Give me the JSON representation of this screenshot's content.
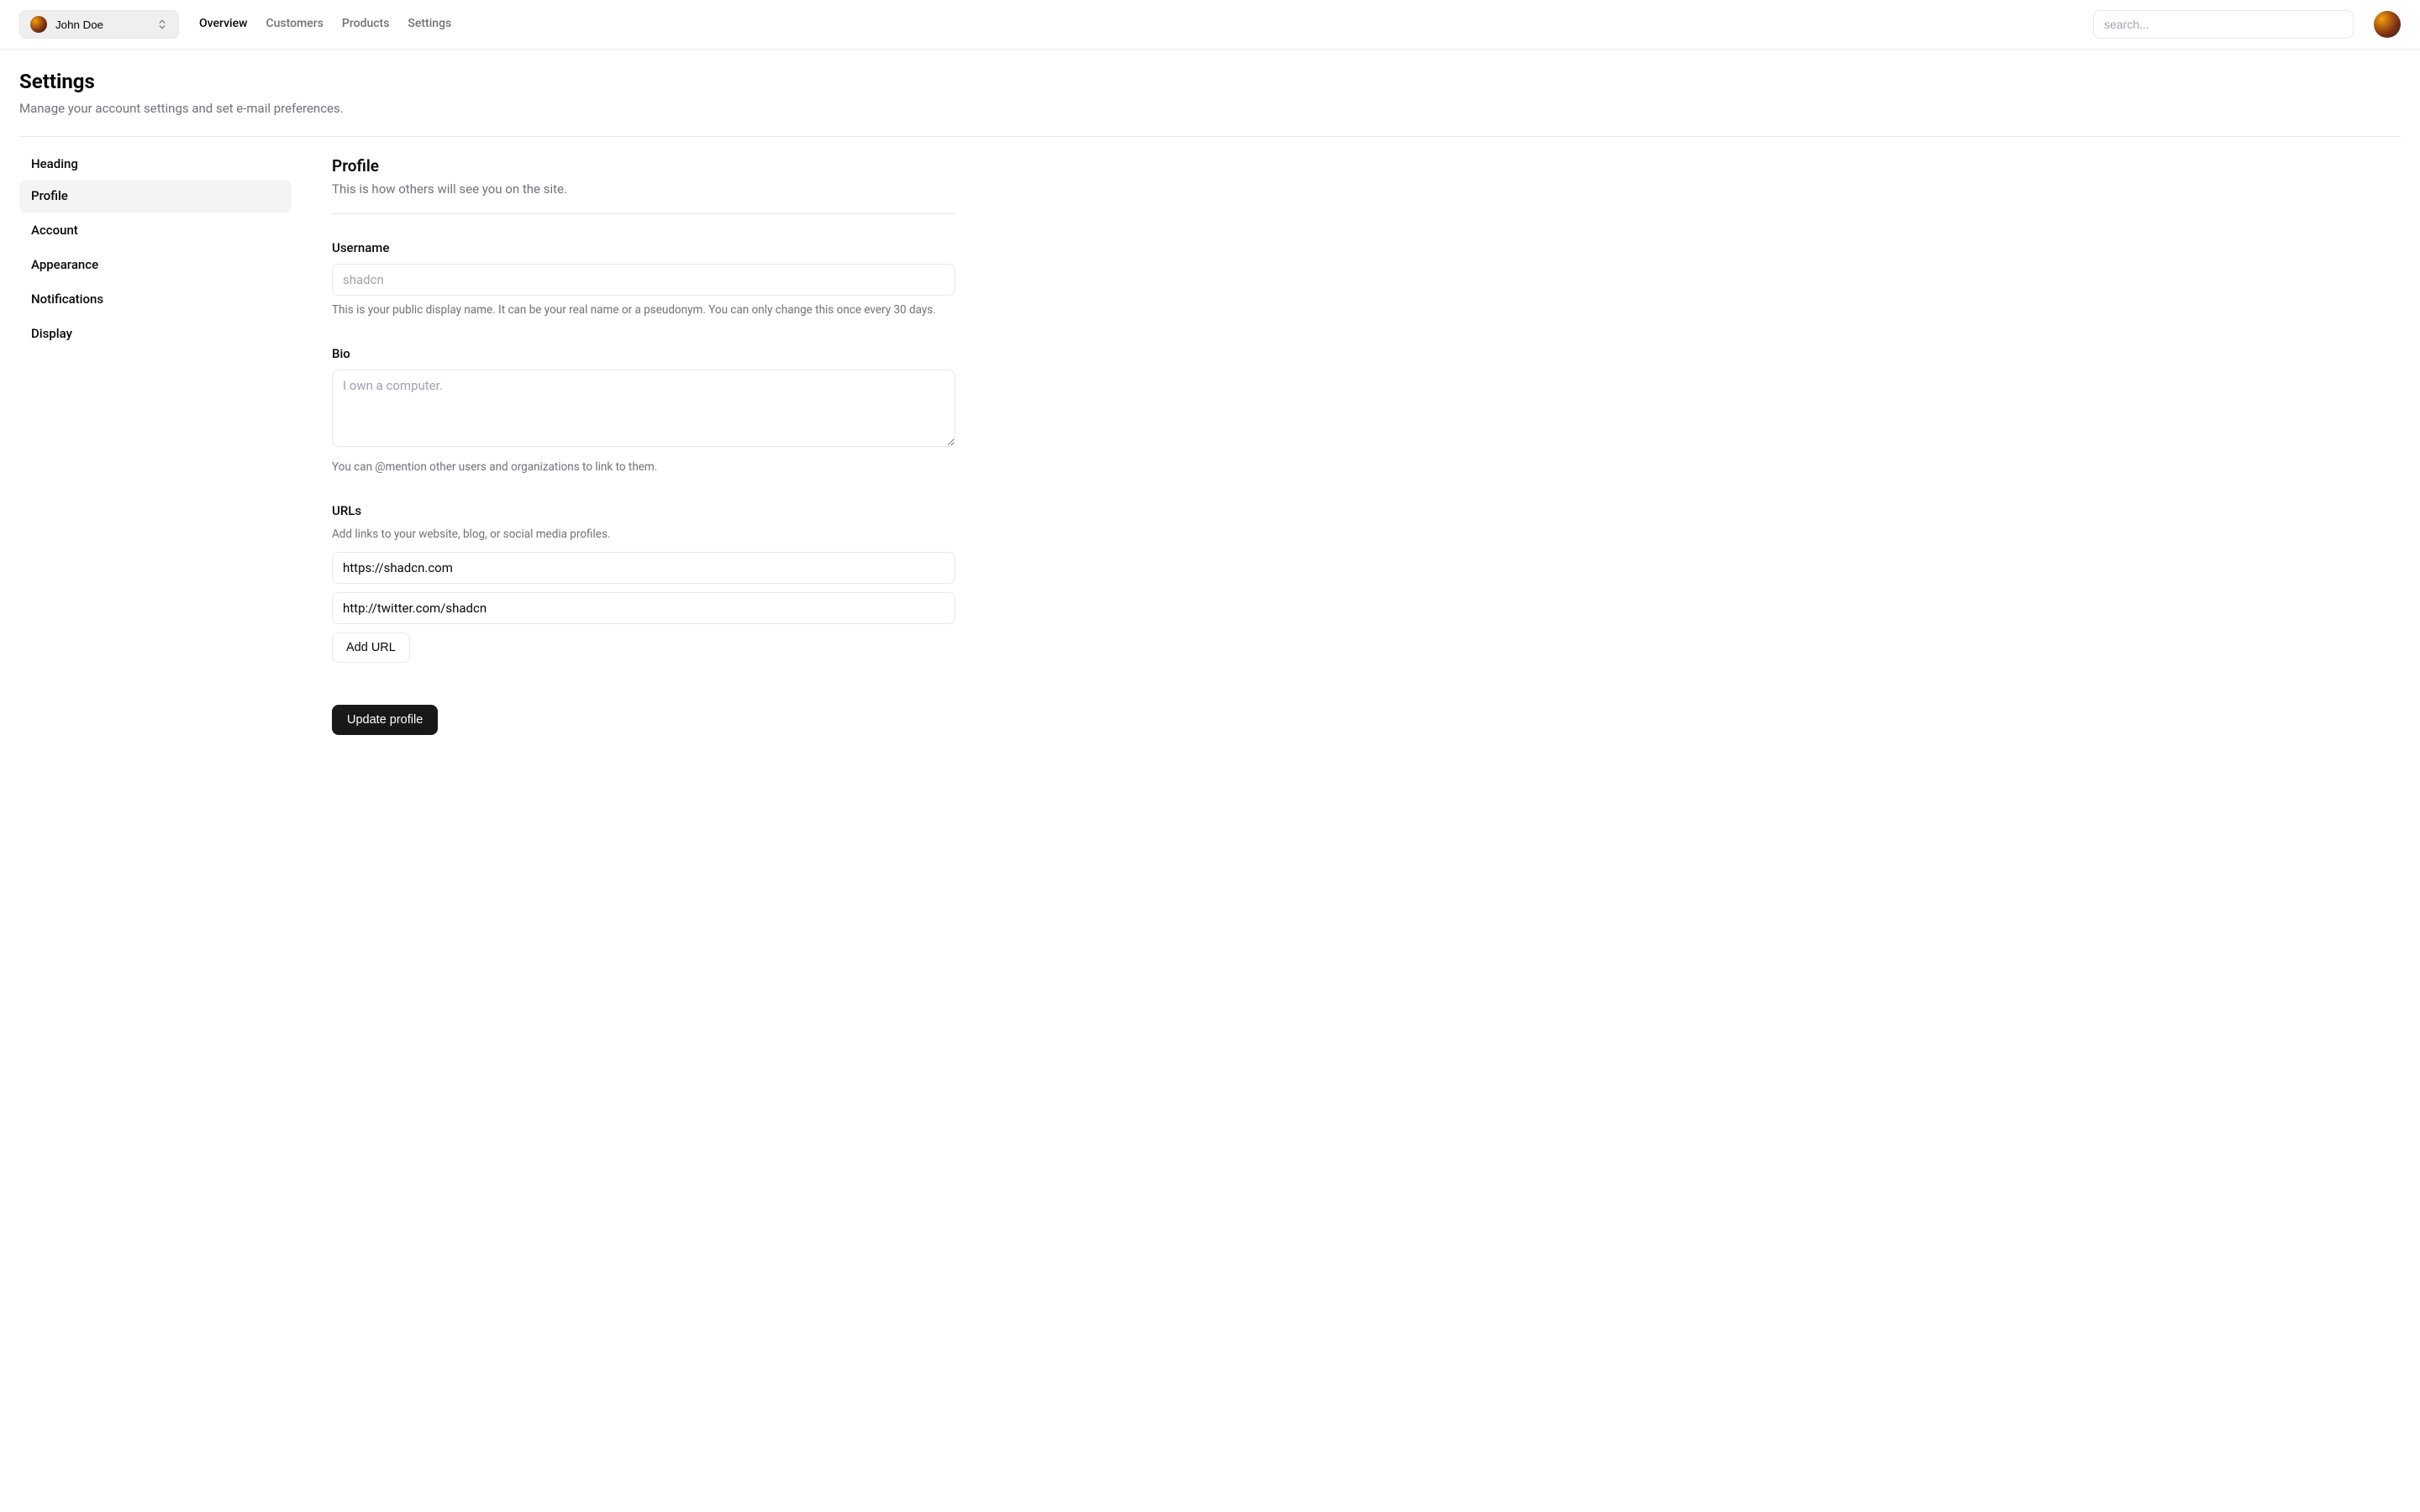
{
  "topbar": {
    "team_name": "John Doe",
    "nav": [
      {
        "label": "Overview",
        "active": true
      },
      {
        "label": "Customers",
        "active": false
      },
      {
        "label": "Products",
        "active": false
      },
      {
        "label": "Settings",
        "active": false
      }
    ],
    "search_placeholder": "search..."
  },
  "page": {
    "title": "Settings",
    "subtitle": "Manage your account settings and set e-mail preferences."
  },
  "sidebar": {
    "heading": "Heading",
    "items": [
      {
        "label": "Profile",
        "active": true
      },
      {
        "label": "Account",
        "active": false
      },
      {
        "label": "Appearance",
        "active": false
      },
      {
        "label": "Notifications",
        "active": false
      },
      {
        "label": "Display",
        "active": false
      }
    ]
  },
  "profile": {
    "title": "Profile",
    "subtitle": "This is how others will see you on the site.",
    "username": {
      "label": "Username",
      "placeholder": "shadcn",
      "value": "",
      "help": "This is your public display name. It can be your real name or a pseudonym. You can only change this once every 30 days."
    },
    "bio": {
      "label": "Bio",
      "placeholder": "I own a computer.",
      "value": "",
      "help": "You can @mention other users and organizations to link to them."
    },
    "urls": {
      "label": "URLs",
      "help": "Add links to your website, blog, or social media profiles.",
      "values": [
        "https://shadcn.com",
        "http://twitter.com/shadcn"
      ],
      "add_label": "Add URL"
    },
    "submit_label": "Update profile"
  }
}
